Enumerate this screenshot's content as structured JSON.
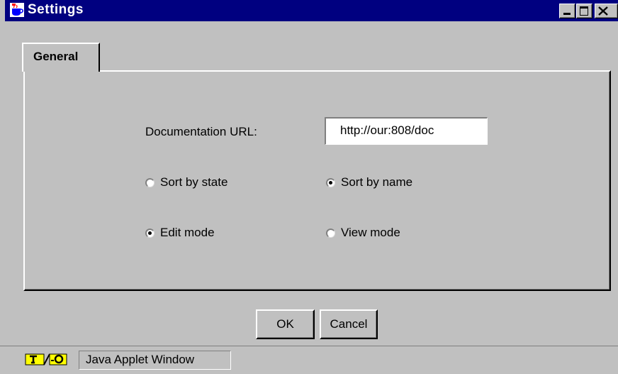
{
  "window": {
    "title": "Settings",
    "title_bar_color": "#000080",
    "controls": [
      "minimize-icon",
      "maximize-icon",
      "close-icon"
    ]
  },
  "tabs": [
    {
      "label": "General",
      "selected": true
    }
  ],
  "general": {
    "doc_url_label": "Documentation URL:",
    "doc_url_value": "http://our:808/doc",
    "sort_by_state": {
      "label": "Sort by state",
      "checked": false
    },
    "sort_by_name": {
      "label": "Sort by name",
      "checked": true
    },
    "edit_mode": {
      "label": "Edit mode",
      "checked": true
    },
    "view_mode": {
      "label": "View mode",
      "checked": false
    }
  },
  "buttons": {
    "ok": "OK",
    "cancel": "Cancel"
  },
  "status": {
    "applet_icon": "java-applet-icon",
    "applet_label": "Java Applet Window"
  }
}
